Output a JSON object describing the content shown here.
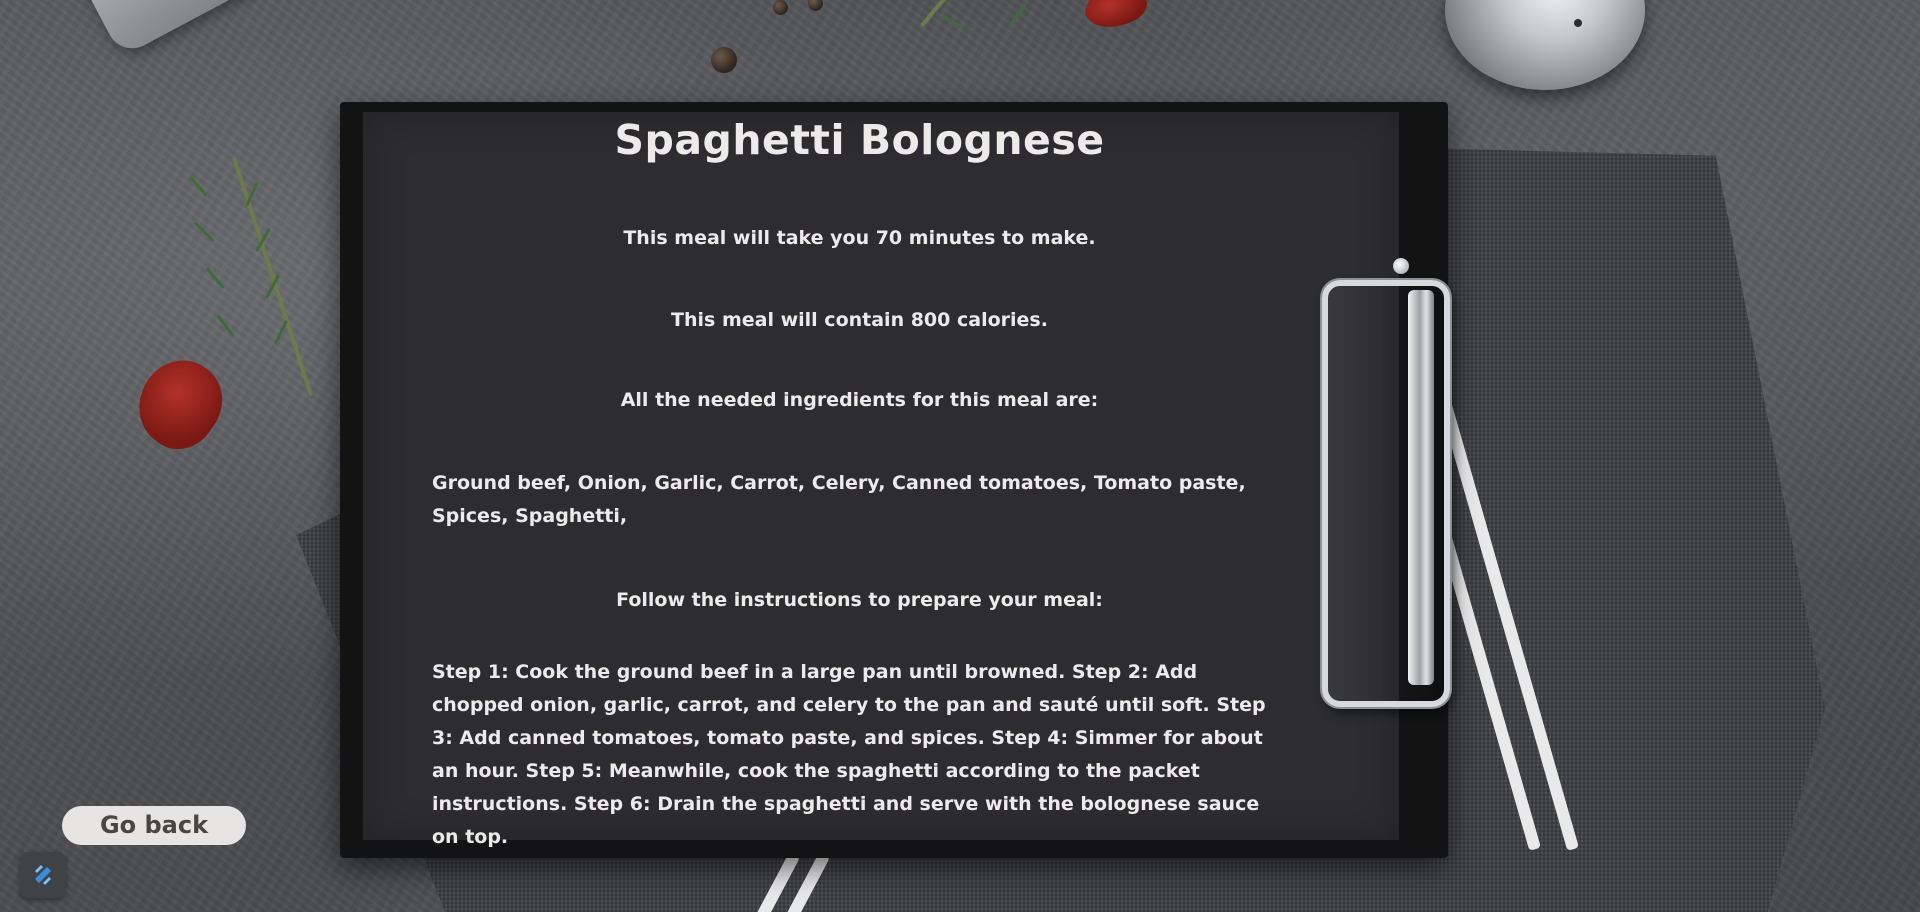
{
  "recipe": {
    "title": "Spaghetti Bolognese",
    "time_text": "This meal will take you 70 minutes to make.",
    "calories_text": "This meal will contain 800 calories.",
    "ingredients_heading": "All the needed ingredients for this meal are:",
    "ingredients": "Ground beef, Onion, Garlic, Carrot, Celery, Canned tomatoes, Tomato paste, Spices, Spaghetti,",
    "instructions_heading": "Follow the instructions to prepare your meal:",
    "instructions": "Step 1: Cook the ground beef in a large pan until browned. Step 2: Add chopped onion, garlic, carrot, and celery to the pan and sauté until soft. Step 3: Add canned tomatoes, tomato paste, and spices. Step 4: Simmer for about an hour. Step 5: Meanwhile, cook the spaghetti according to the packet instructions. Step 6: Drain the spaghetti and serve with the bolognese sauce on top."
  },
  "navigation": {
    "go_back_label": "Go back"
  },
  "icons": {
    "app_badge": "app-logo-icon"
  },
  "colors": {
    "paper": "#2d2d30",
    "text": "#ecebea",
    "button_bg": "#e7e5e3",
    "button_text": "#474747"
  }
}
